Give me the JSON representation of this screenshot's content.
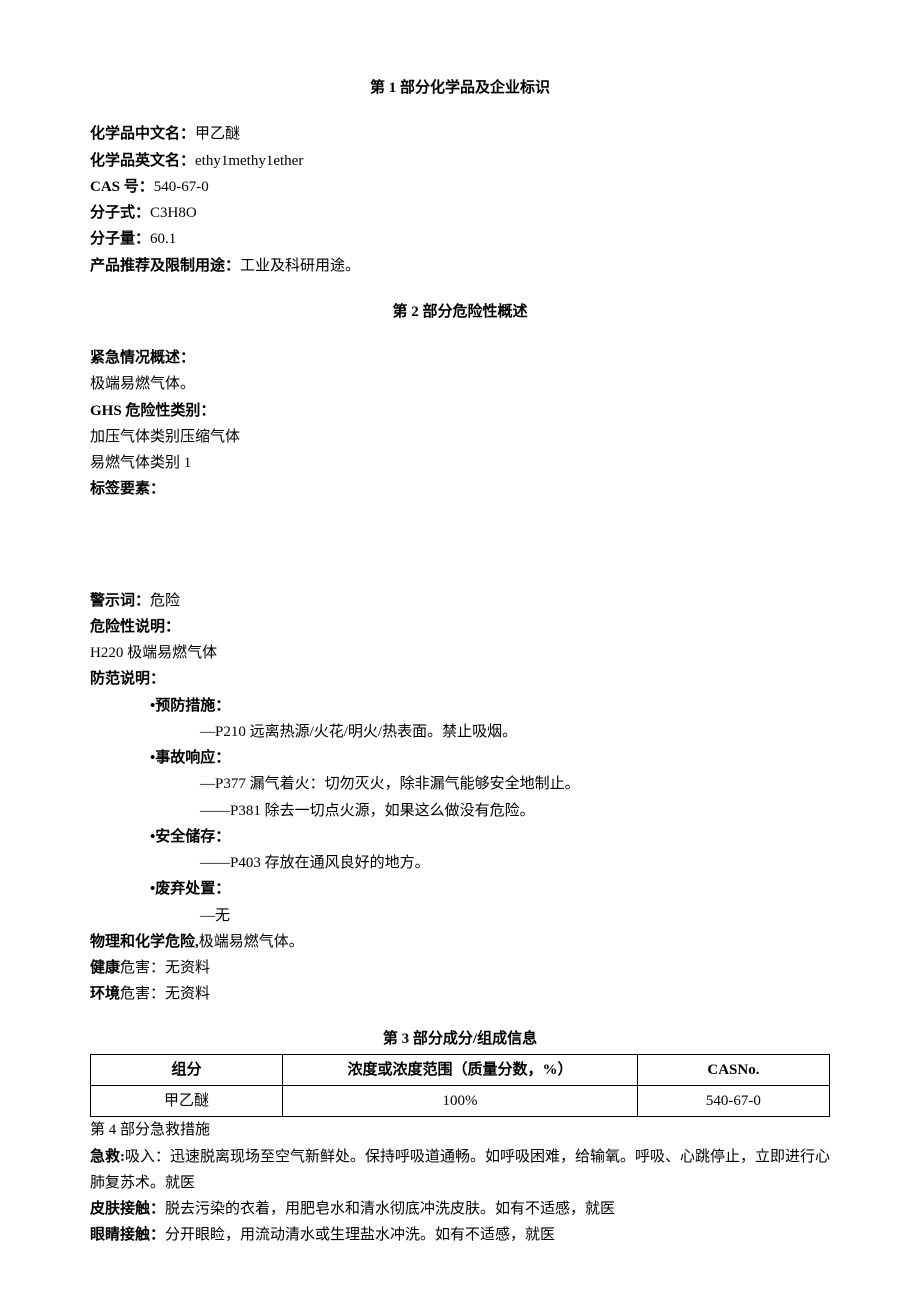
{
  "section1": {
    "title": "第 1 部分化学品及企业标识",
    "name_cn_label": "化学品中文名：",
    "name_cn": "甲乙醚",
    "name_en_label": "化学品英文名：",
    "name_en": "ethy1methy1ether",
    "cas_label": "CAS 号：",
    "cas": "540-67-0",
    "formula_label": "分子式：",
    "formula": "C3H8O",
    "mw_label": "分子量：",
    "mw": "60.1",
    "use_label": "产品推荐及限制用途：",
    "use": "工业及科研用途。"
  },
  "section2": {
    "title": "第 2 部分危险性概述",
    "emergency_label": "紧急情况概述：",
    "emergency": "极端易燃气体。",
    "ghs_label": "GHS 危险性类别：",
    "ghs1": "加压气体类别压缩气体",
    "ghs2": "易燃气体类别 1",
    "label_elements": "标签要素：",
    "signal_label": "警示词：",
    "signal": "危险",
    "hazard_label": "危险性说明：",
    "h220": "H220 极端易燃气体",
    "precaution_label": "防范说明：",
    "prevent_label": "•预防措施：",
    "p210": "—P210 远离热源/火花/明火/热表面。禁止吸烟。",
    "response_label": "•事故响应：",
    "p377": "—P377 漏气着火：切勿灭火，除非漏气能够安全地制止。",
    "p381": "——P381 除去一切点火源，如果这么做没有危险。",
    "storage_label": "•安全储存：",
    "p403": "——P403 存放在通风良好的地方。",
    "disposal_label": "•废弃处置：",
    "disposal": "—无",
    "phys_label": "物理和化学危险,",
    "phys": "极端易燃气体。",
    "health_label": "健康",
    "health": "危害：无资料",
    "env_label": "环境",
    "env": "危害：无资料"
  },
  "section3": {
    "title": "第 3 部分成分/组成信息",
    "th1": "组分",
    "th2": "浓度或浓度范围（质量分数，%）",
    "th3": "CASNo.",
    "td1": "甲乙醚",
    "td2": "100%",
    "td3": "540-67-0"
  },
  "section4": {
    "title": "第 4 部分急救措施",
    "inhale_label": "急救:",
    "inhale": "吸入：迅速脱离现场至空气新鲜处。保持呼吸道通畅。如呼吸困难，给输氧。呼吸、心跳停止，立即进行心肺复苏术。就医",
    "skin_label": "皮肤接触：",
    "skin": "脱去污染的衣着，用肥皂水和清水彻底冲洗皮肤。如有不适感，就医",
    "eye_label": "眼睛接触：",
    "eye": "分开眼睑，用流动清水或生理盐水冲洗。如有不适感，就医"
  }
}
